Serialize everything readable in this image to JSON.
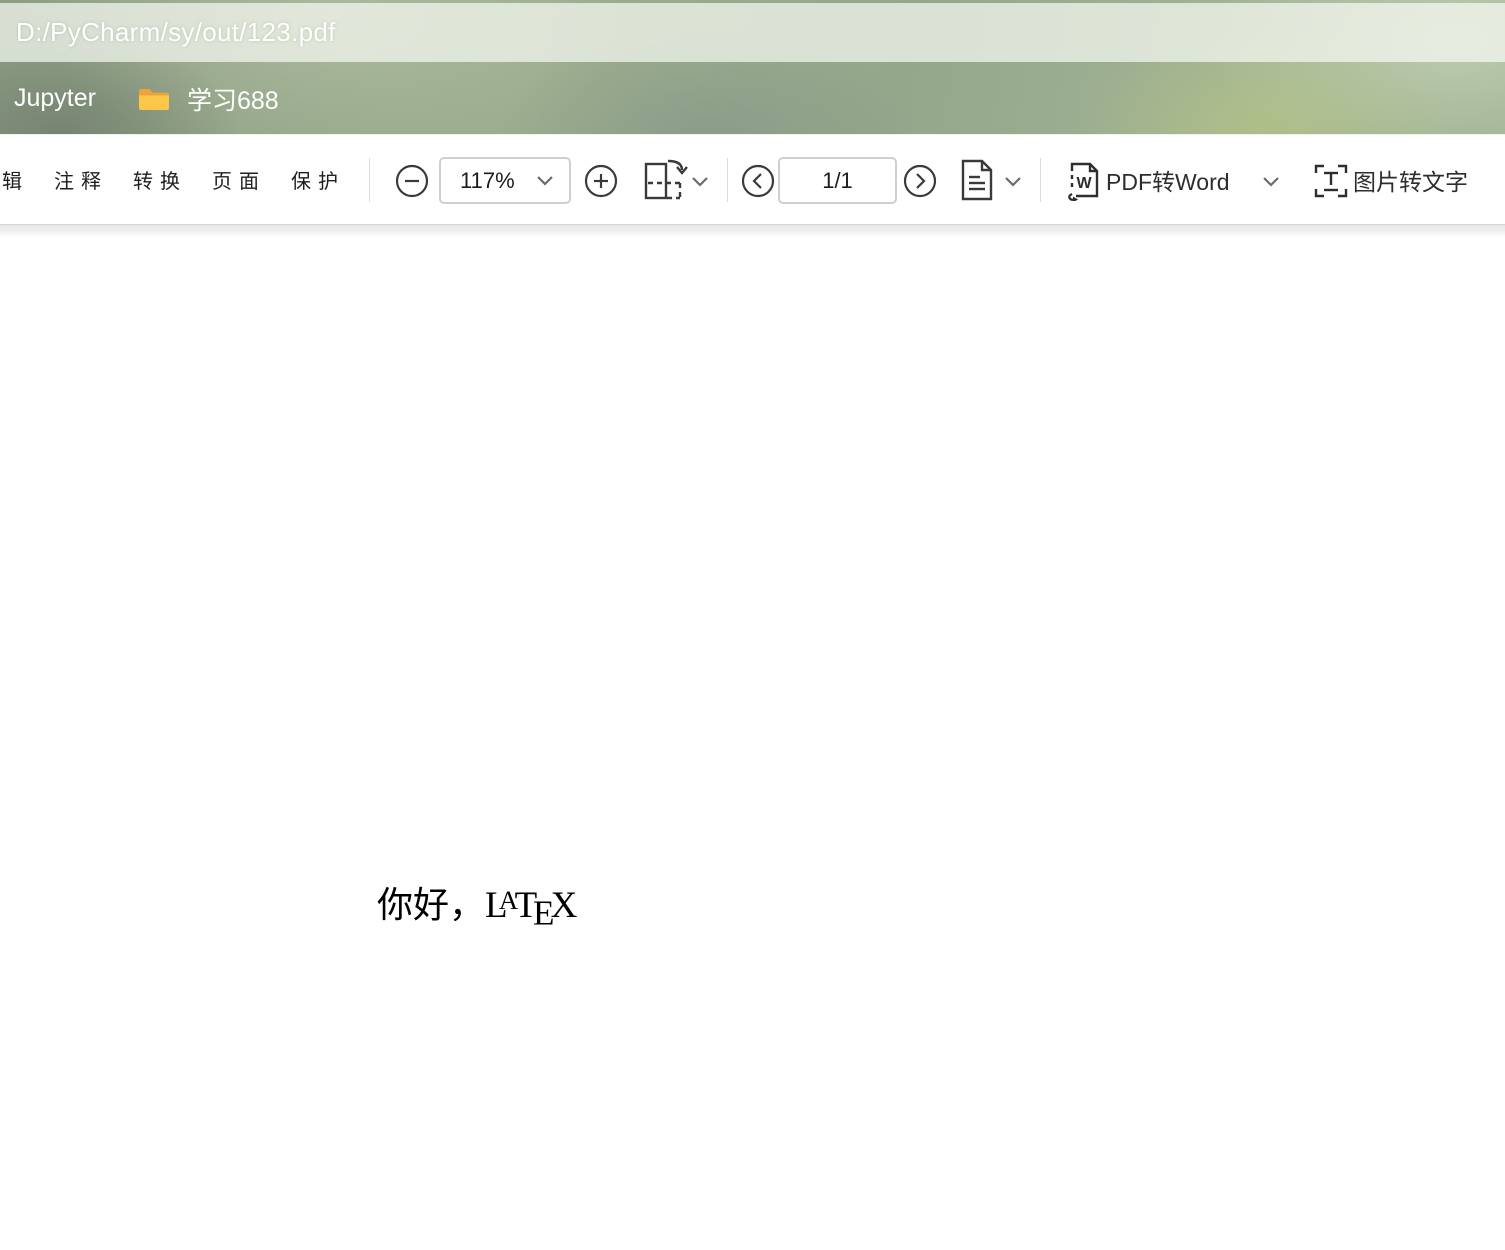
{
  "window": {
    "title_path": "D:/PyCharm/sy/out/123.pdf"
  },
  "tabbar": {
    "tabs": [
      {
        "label": "Jupyter"
      },
      {
        "label": "学习688",
        "icon": "folder-icon"
      }
    ]
  },
  "toolbar": {
    "menu_items": [
      {
        "label": "辑"
      },
      {
        "label": "注释"
      },
      {
        "label": "转换"
      },
      {
        "label": "页面"
      },
      {
        "label": "保护"
      }
    ],
    "zoom_value": "117%",
    "page_indicator": "1/1",
    "pdf_to_word_label": "PDF转Word",
    "ocr_label": "图片转文字"
  },
  "document": {
    "greeting_prefix": "你好，",
    "latex_logo_parts": {
      "L": "L",
      "A": "A",
      "T": "T",
      "E": "E",
      "X": "X"
    }
  },
  "icons": {
    "folder-icon": "yellow folder",
    "zoom-out-icon": "circled minus",
    "zoom-in-icon": "circled plus",
    "rotate-page-icon": "page outline with dashed result and curved arrow",
    "prev-page-icon": "circled chevron left",
    "next-page-icon": "circled chevron right",
    "page-view-icon": "document with text lines",
    "pdf-to-word-icon": "document with W and convert arrow",
    "ocr-icon": "capture frame with letter T",
    "chevron-down-icon": "dropdown chevron"
  },
  "colors": {
    "header_green": "#9cab8c",
    "titlebar_overlay": "#e0e8d9",
    "titlebar_text": "#ffffff",
    "toolbar_bg": "#ffffff",
    "toolbar_text": "#1f1f1f",
    "icon_stroke": "#3a3a3a",
    "folder_yellow_front": "#fcc64b",
    "folder_yellow_back": "#eca43a",
    "content_bg": "#ffffff",
    "doc_text": "#000000"
  }
}
